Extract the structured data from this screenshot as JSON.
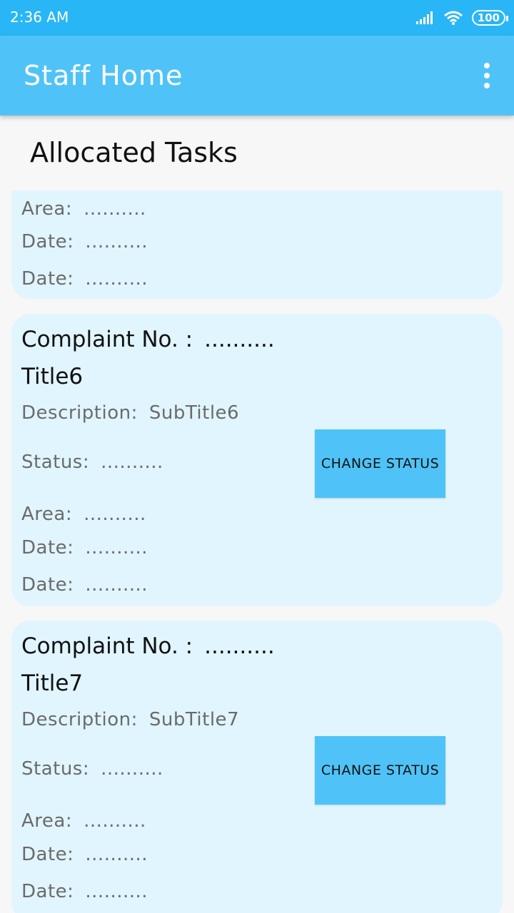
{
  "status_bar": {
    "time": "2:36 AM",
    "battery": "100"
  },
  "app_bar": {
    "title": "Staff Home"
  },
  "section": {
    "title": "Allocated Tasks"
  },
  "labels": {
    "complaint_no": "Complaint No. :",
    "description": "Description:",
    "status": "Status:",
    "area": "Area:",
    "date": "Date:",
    "change_status": "CHANGE STATUS"
  },
  "cards": [
    {
      "area": "..........",
      "date1": "..........",
      "date2": ".........."
    },
    {
      "complaint_no": "..........",
      "title": "Title6",
      "description": "SubTitle6",
      "status": "..........",
      "area": "..........",
      "date1": "..........",
      "date2": ".........."
    },
    {
      "complaint_no": "..........",
      "title": "Title7",
      "description": "SubTitle7",
      "status": "..........",
      "area": "..........",
      "date1": "..........",
      "date2": ".........."
    }
  ],
  "colors": {
    "status_bar": "#29b6f6",
    "app_bar": "#4fc3f7",
    "card": "#e1f5fe",
    "button": "#4fc3f7"
  }
}
